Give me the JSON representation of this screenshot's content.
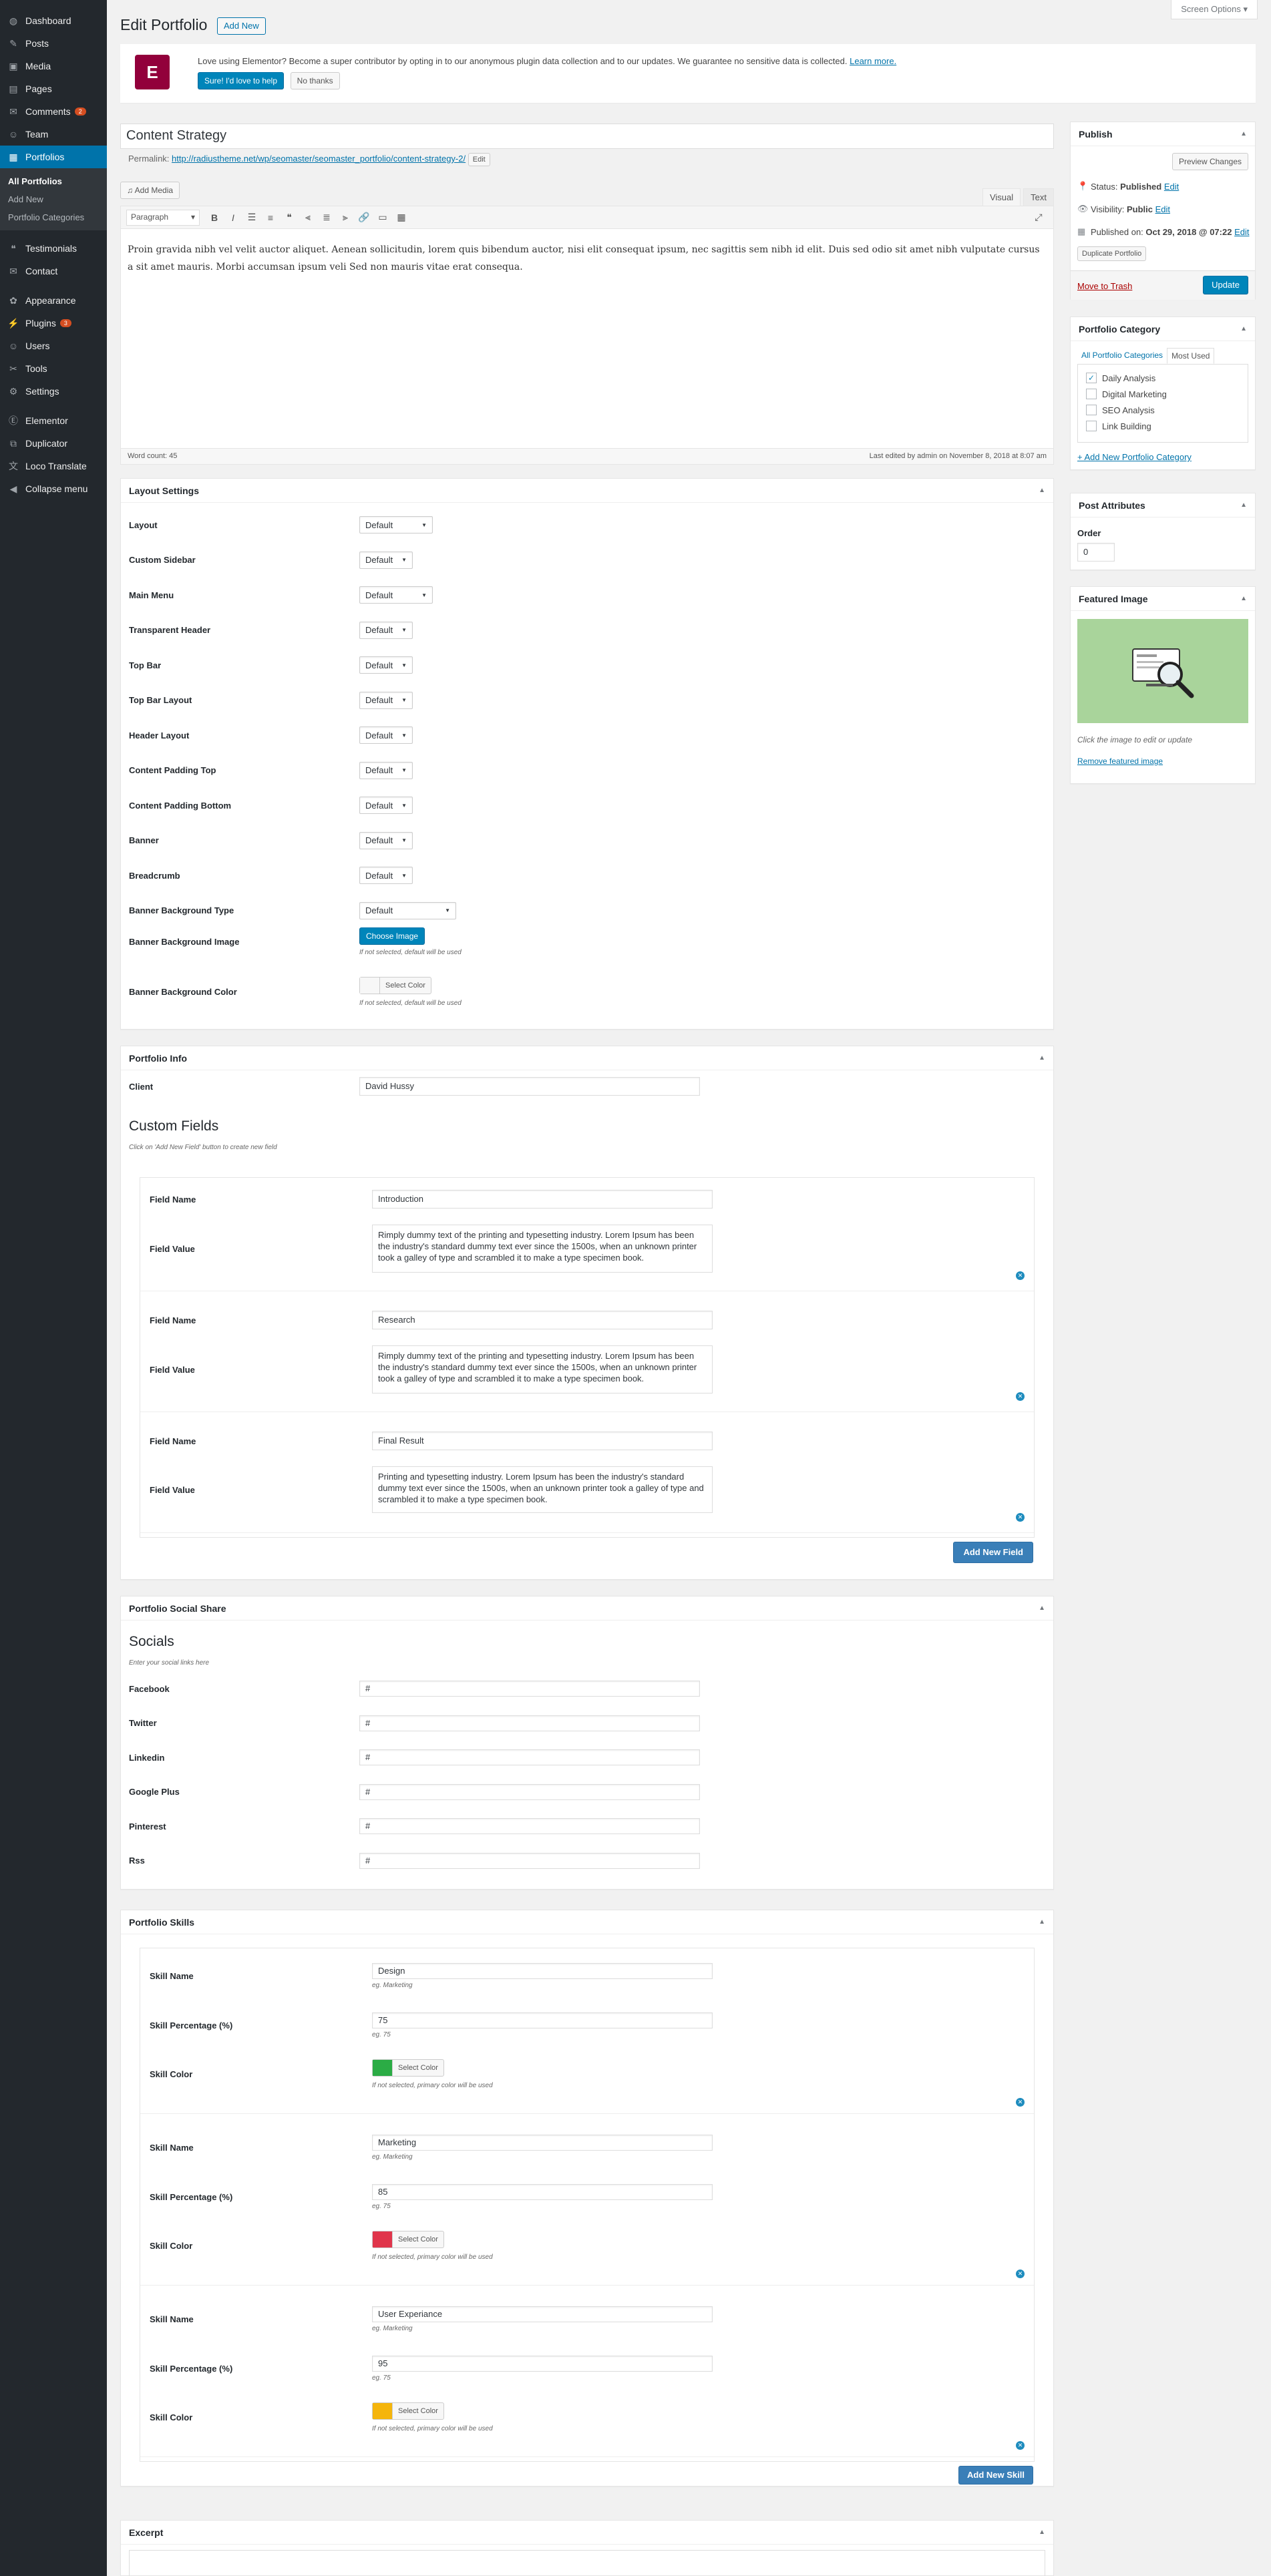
{
  "sidebar": {
    "items": [
      {
        "label": "Dashboard",
        "icon": "dashboard-icon",
        "glyph": "◍"
      },
      {
        "label": "Posts",
        "icon": "pin-icon",
        "glyph": "✎"
      },
      {
        "label": "Media",
        "icon": "media-icon",
        "glyph": "▣"
      },
      {
        "label": "Pages",
        "icon": "pages-icon",
        "glyph": "▤"
      },
      {
        "label": "Comments",
        "icon": "comments-icon",
        "glyph": "✉",
        "badge": "2"
      },
      {
        "label": "Team",
        "icon": "team-icon",
        "glyph": "☺"
      },
      {
        "label": "Portfolios",
        "icon": "portfolio-icon",
        "glyph": "▦"
      }
    ],
    "submenu": [
      "All Portfolios",
      "Add New",
      "Portfolio Categories"
    ],
    "items2": [
      {
        "label": "Testimonials",
        "icon": "testimonial-icon",
        "glyph": "❝"
      },
      {
        "label": "Contact",
        "icon": "mail-icon",
        "glyph": "✉"
      }
    ],
    "items3": [
      {
        "label": "Appearance",
        "icon": "appearance-icon",
        "glyph": "✿"
      },
      {
        "label": "Plugins",
        "icon": "plugins-icon",
        "glyph": "⚡",
        "badge": "3"
      },
      {
        "label": "Users",
        "icon": "users-icon",
        "glyph": "☺"
      },
      {
        "label": "Tools",
        "icon": "tools-icon",
        "glyph": "✂"
      },
      {
        "label": "Settings",
        "icon": "settings-icon",
        "glyph": "⚙"
      }
    ],
    "items4": [
      {
        "label": "Elementor",
        "icon": "elementor-icon",
        "glyph": "Ⓔ"
      },
      {
        "label": "Duplicator",
        "icon": "duplicator-icon",
        "glyph": "⧉"
      },
      {
        "label": "Loco Translate",
        "icon": "translate-icon",
        "glyph": "文"
      },
      {
        "label": "Collapse menu",
        "icon": "collapse-icon",
        "glyph": "◀"
      }
    ]
  },
  "header": {
    "title": "Edit Portfolio",
    "add_new": "Add New",
    "screen_options": "Screen Options ▾"
  },
  "notice": {
    "text": "Love using Elementor? Become a super contributor by opting in to our anonymous plugin data collection and to our updates. We guarantee no sensitive data is collected.",
    "link": "Learn more.",
    "yes": "Sure! I'd love to help",
    "no": "No thanks"
  },
  "post": {
    "title": "Content Strategy",
    "permalink_label": "Permalink:",
    "permalink_url": "http://radiustheme.net/wp/seomaster/seomaster_portfolio/content-strategy-2/",
    "permalink_edit": "Edit"
  },
  "editor": {
    "add_media": "Add Media",
    "tab_visual": "Visual",
    "tab_text": "Text",
    "format": "Paragraph",
    "content": "Proin gravida nibh vel velit auctor aliquet. Aenean sollicitudin, lorem quis bibendum auctor, nisi elit consequat ipsum, nec sagittis sem nibh id elit. Duis sed odio sit amet nibh vulputate cursus a sit amet mauris. Morbi accumsan ipsum veli Sed non mauris vitae erat consequa.",
    "word_count": "Word count: 45",
    "last_edited": "Last edited by admin on November 8, 2018 at 8:07 am"
  },
  "layout": {
    "title": "Layout Settings",
    "rows": [
      {
        "label": "Layout",
        "value": "Default"
      },
      {
        "label": "Custom Sidebar",
        "value": "Default"
      },
      {
        "label": "Main Menu",
        "value": "Default"
      },
      {
        "label": "Transparent Header",
        "value": "Default"
      },
      {
        "label": "Top Bar",
        "value": "Default"
      },
      {
        "label": "Top Bar Layout",
        "value": "Default"
      },
      {
        "label": "Header Layout",
        "value": "Default"
      },
      {
        "label": "Content Padding Top",
        "value": "Default"
      },
      {
        "label": "Content Padding Bottom",
        "value": "Default"
      },
      {
        "label": "Banner",
        "value": "Default"
      },
      {
        "label": "Breadcrumb",
        "value": "Default"
      },
      {
        "label": "Banner Background Type",
        "value": "Default"
      }
    ],
    "bg_image_label": "Banner Background Image",
    "choose_image": "Choose Image",
    "bg_image_hint": "If not selected, default will be used",
    "bg_color_label": "Banner Background Color",
    "select_color": "Select Color",
    "bg_color_hint": "If not selected, default will be used"
  },
  "info": {
    "title": "Portfolio Info",
    "client_label": "Client",
    "client_value": "David Hussy",
    "custom_title": "Custom Fields",
    "custom_hint": "Click on 'Add New Field' button to create new field",
    "field_name_label": "Field Name",
    "field_value_label": "Field Value",
    "fields": [
      {
        "name": "Introduction",
        "value": "Rimply dummy text of the printing and typesetting industry. Lorem Ipsum has been the industry's standard dummy text ever since the 1500s, when an unknown printer took a galley of type and scrambled it to make a type specimen book."
      },
      {
        "name": "Research",
        "value": "Rimply dummy text of the printing and typesetting industry. Lorem Ipsum has been the industry's standard dummy text ever since the 1500s, when an unknown printer took a galley of type and scrambled it to make a type specimen book."
      },
      {
        "name": "Final Result",
        "value": "Printing and typesetting industry. Lorem Ipsum has been the industry's standard dummy text ever since the 1500s, when an unknown printer took a galley of type and scrambled it to make a type specimen book."
      }
    ],
    "add_field": "Add New Field"
  },
  "social": {
    "title": "Portfolio Social Share",
    "heading": "Socials",
    "hint": "Enter your social links here",
    "rows": [
      {
        "label": "Facebook",
        "value": "#"
      },
      {
        "label": "Twitter",
        "value": "#"
      },
      {
        "label": "Linkedin",
        "value": "#"
      },
      {
        "label": "Google Plus",
        "value": "#"
      },
      {
        "label": "Pinterest",
        "value": "#"
      },
      {
        "label": "Rss",
        "value": "#"
      }
    ]
  },
  "skills": {
    "title": "Portfolio Skills",
    "name_label": "Skill Name",
    "name_hint": "eg. Marketing",
    "pct_label": "Skill Percentage (%)",
    "pct_hint": "eg. 75",
    "color_label": "Skill Color",
    "color_btn": "Select Color",
    "color_hint": "If not selected, primary color will be used",
    "items": [
      {
        "name": "Design",
        "percent": "75",
        "color": "#2bac45"
      },
      {
        "name": "Marketing",
        "percent": "85",
        "color": "#e0354b"
      },
      {
        "name": "User Experiance",
        "percent": "95",
        "color": "#f5b50c"
      }
    ],
    "add_skill": "Add New Skill"
  },
  "excerpt": {
    "title": "Excerpt"
  },
  "publish": {
    "title": "Publish",
    "preview": "Preview Changes",
    "status_label": "Status:",
    "status_value": "Published",
    "visibility_label": "Visibility:",
    "visibility_value": "Public",
    "published_label": "Published on:",
    "published_value": "Oct 29, 2018 @ 07:22",
    "edit": "Edit",
    "duplicate": "Duplicate Portfolio",
    "trash": "Move to Trash",
    "update": "Update"
  },
  "category": {
    "title": "Portfolio Category",
    "tab_all": "All Portfolio Categories",
    "tab_used": "Most Used",
    "items": [
      {
        "label": "Daily Analysis",
        "checked": true
      },
      {
        "label": "Digital Marketing",
        "checked": false
      },
      {
        "label": "SEO Analysis",
        "checked": false
      },
      {
        "label": "Link Building",
        "checked": false
      }
    ],
    "add": "+ Add New Portfolio Category"
  },
  "attributes": {
    "title": "Post Attributes",
    "order_label": "Order",
    "order_value": "0"
  },
  "featured": {
    "title": "Featured Image",
    "hint": "Click the image to edit or update",
    "remove": "Remove featured image",
    "bg": "#a9d49b"
  },
  "colors": {
    "accent": "#0073aa",
    "sidebar": "#23282d",
    "active": "#0073aa"
  }
}
